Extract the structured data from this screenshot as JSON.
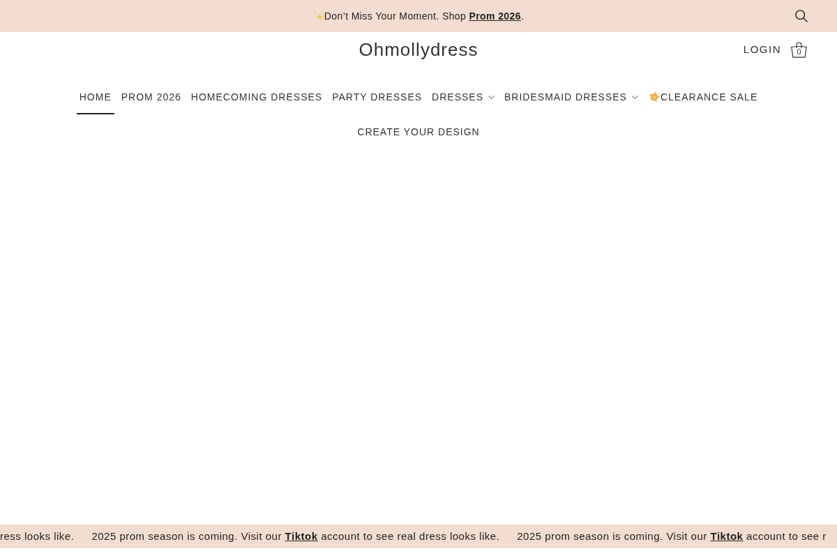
{
  "announcement_bar": {
    "before": "Don’t Miss Your Moment. Shop ",
    "link": "Prom 2026",
    "after": "."
  },
  "header": {
    "logo": "Ohmollydress",
    "login": "LOGIN",
    "cart_count": "0"
  },
  "nav": {
    "items": [
      {
        "label": "HOME",
        "kind": "link",
        "selected": true
      },
      {
        "label": "PROM 2026",
        "kind": "link",
        "selected": false
      },
      {
        "label": "HOMECOMING DRESSES",
        "kind": "link",
        "selected": false
      },
      {
        "label": "PARTY DRESSES",
        "kind": "link",
        "selected": false
      },
      {
        "label": "DRESSES",
        "kind": "dropdown",
        "selected": false
      },
      {
        "label": "BRIDESMAID DRESSES",
        "kind": "dropdown",
        "selected": false
      },
      {
        "label": "CLEARANCE SALE",
        "kind": "promo",
        "selected": false
      },
      {
        "label": "CREATE YOUR DESIGN",
        "kind": "link",
        "selected": false
      }
    ]
  },
  "marquee": [
    {
      "before": "ress looks like."
    },
    {
      "before": "2025 prom season is coming. Visit our",
      "link": "Tiktok",
      "after": "account to see real dress looks like."
    },
    {
      "before": "2025 prom season is coming. Visit our",
      "link": "Tiktok",
      "after": "account to see r"
    }
  ]
}
